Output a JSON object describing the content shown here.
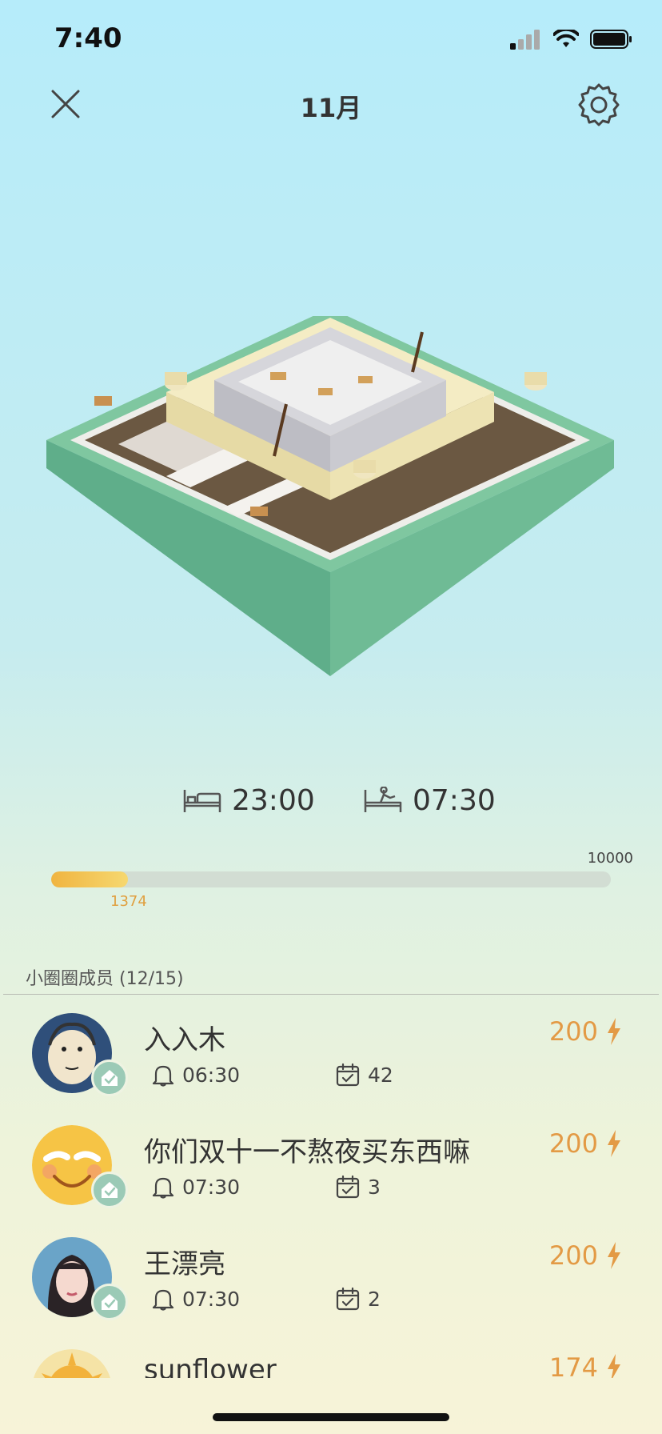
{
  "status": {
    "time": "7:40"
  },
  "nav": {
    "title": "11月"
  },
  "sleep": {
    "bedtime": "23:00",
    "wakeup": "07:30"
  },
  "progress": {
    "current": "1374",
    "max": "10000",
    "fraction": 0.1374
  },
  "members": {
    "title": "小圈圈成员 (12/15)",
    "list": [
      {
        "name": "入入木",
        "alarm": "06:30",
        "days": "42",
        "energy": "200"
      },
      {
        "name": "你们双十一不熬夜买东西嘛",
        "alarm": "07:30",
        "days": "3",
        "energy": "200"
      },
      {
        "name": "王漂亮",
        "alarm": "07:30",
        "days": "2",
        "energy": "200"
      },
      {
        "name": "sunflower",
        "energy": "174"
      }
    ]
  },
  "colors": {
    "accent": "#e39a45",
    "progress": "#f0b440",
    "badge": "#9bcab6"
  }
}
